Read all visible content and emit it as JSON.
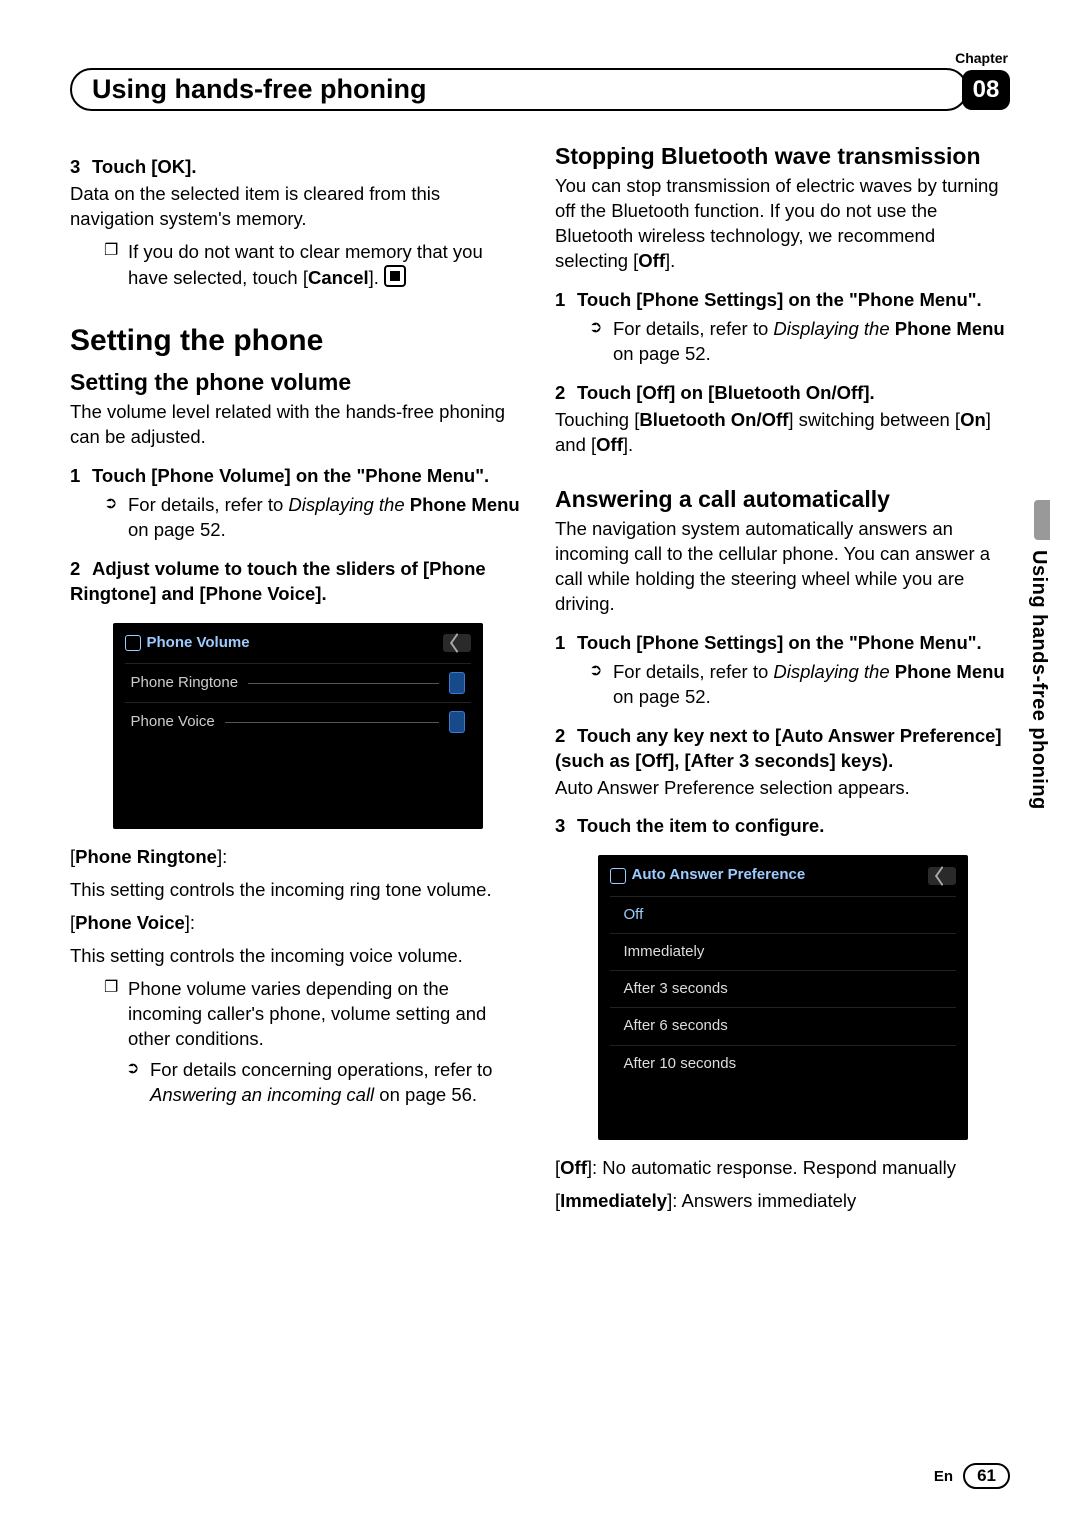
{
  "header": {
    "chapter_label": "Chapter",
    "title": "Using hands-free phoning",
    "chapter_num": "08"
  },
  "side_tab": "Using hands-free phoning",
  "footer": {
    "lang": "En",
    "page": "61"
  },
  "left": {
    "step3_label": "3",
    "step3_text": "Touch [OK].",
    "step3_body": "Data on the selected item is cleared from this navigation system's memory.",
    "note1_pre": "If you do not want to clear memory that you have selected, touch [",
    "note1_bold": "Cancel",
    "note1_post": "].",
    "h1": "Setting the phone",
    "h2a": "Setting the phone volume",
    "h2a_body": "The volume level related with the hands-free phoning can be adjusted.",
    "s1_label": "1",
    "s1_text": "Touch [Phone Volume] on the \"Phone Menu\".",
    "s1_ref_pre": "For details, refer to ",
    "s1_ref_i": "Displaying the ",
    "s1_ref_b": "Phone Menu",
    "s1_ref_post": " on page 52.",
    "s2_label": "2",
    "s2_text": "Adjust volume to touch the sliders of [Phone Ringtone] and [Phone Voice].",
    "screen1": {
      "title": "Phone Volume",
      "row1": "Phone Ringtone",
      "row2": "Phone Voice"
    },
    "pr_label": "Phone Ringtone",
    "pr_body": "This setting controls the incoming ring tone volume.",
    "pv_label": "Phone Voice",
    "pv_body": "This setting controls the incoming voice volume.",
    "note2": "Phone volume varies depending on the incoming caller's phone, volume setting and other conditions.",
    "note3_pre": "For details concerning operations, refer to ",
    "note3_i": "Answering an incoming call",
    "note3_post": " on page 56."
  },
  "right": {
    "h2b": "Stopping Bluetooth wave transmission",
    "h2b_body_pre": "You can stop transmission of electric waves by turning off the Bluetooth function. If you do not use the Bluetooth wireless technology, we recommend selecting [",
    "h2b_body_b": "Off",
    "h2b_body_post": "].",
    "b_s1_label": "1",
    "b_s1_text": "Touch [Phone Settings] on the \"Phone Menu\".",
    "b_s1_ref_pre": "For details, refer to ",
    "b_s1_ref_i": "Displaying the ",
    "b_s1_ref_b": "Phone Menu",
    "b_s1_ref_post": " on page 52.",
    "b_s2_label": "2",
    "b_s2_text": "Touch [Off] on [Bluetooth On/Off].",
    "b_s2_body_pre": "Touching [",
    "b_s2_body_b1": "Bluetooth On/Off",
    "b_s2_body_mid": "] switching between [",
    "b_s2_body_b2": "On",
    "b_s2_body_mid2": "] and [",
    "b_s2_body_b3": "Off",
    "b_s2_body_post": "].",
    "h2c": "Answering a call automatically",
    "h2c_body": "The navigation system automatically answers an incoming call to the cellular phone. You can answer a call while holding the steering wheel while you are driving.",
    "c_s1_label": "1",
    "c_s1_text": "Touch [Phone Settings] on the \"Phone Menu\".",
    "c_s1_ref_pre": "For details, refer to ",
    "c_s1_ref_i": "Displaying the ",
    "c_s1_ref_b": "Phone Menu",
    "c_s1_ref_post": " on page 52.",
    "c_s2_label": "2",
    "c_s2_text": "Touch any key next to [Auto Answer Preference] (such as [Off], [After 3 seconds] keys).",
    "c_s2_body": "Auto Answer Preference selection appears.",
    "c_s3_label": "3",
    "c_s3_text": "Touch the item to configure.",
    "screen2": {
      "title": "Auto Answer Preference",
      "items": [
        "Off",
        "Immediately",
        "After 3 seconds",
        "After 6 seconds",
        "After 10 seconds"
      ]
    },
    "off_b": "Off",
    "off_t": ": No automatic response. Respond manually",
    "imm_b": "Immediately",
    "imm_t": ": Answers immediately"
  }
}
